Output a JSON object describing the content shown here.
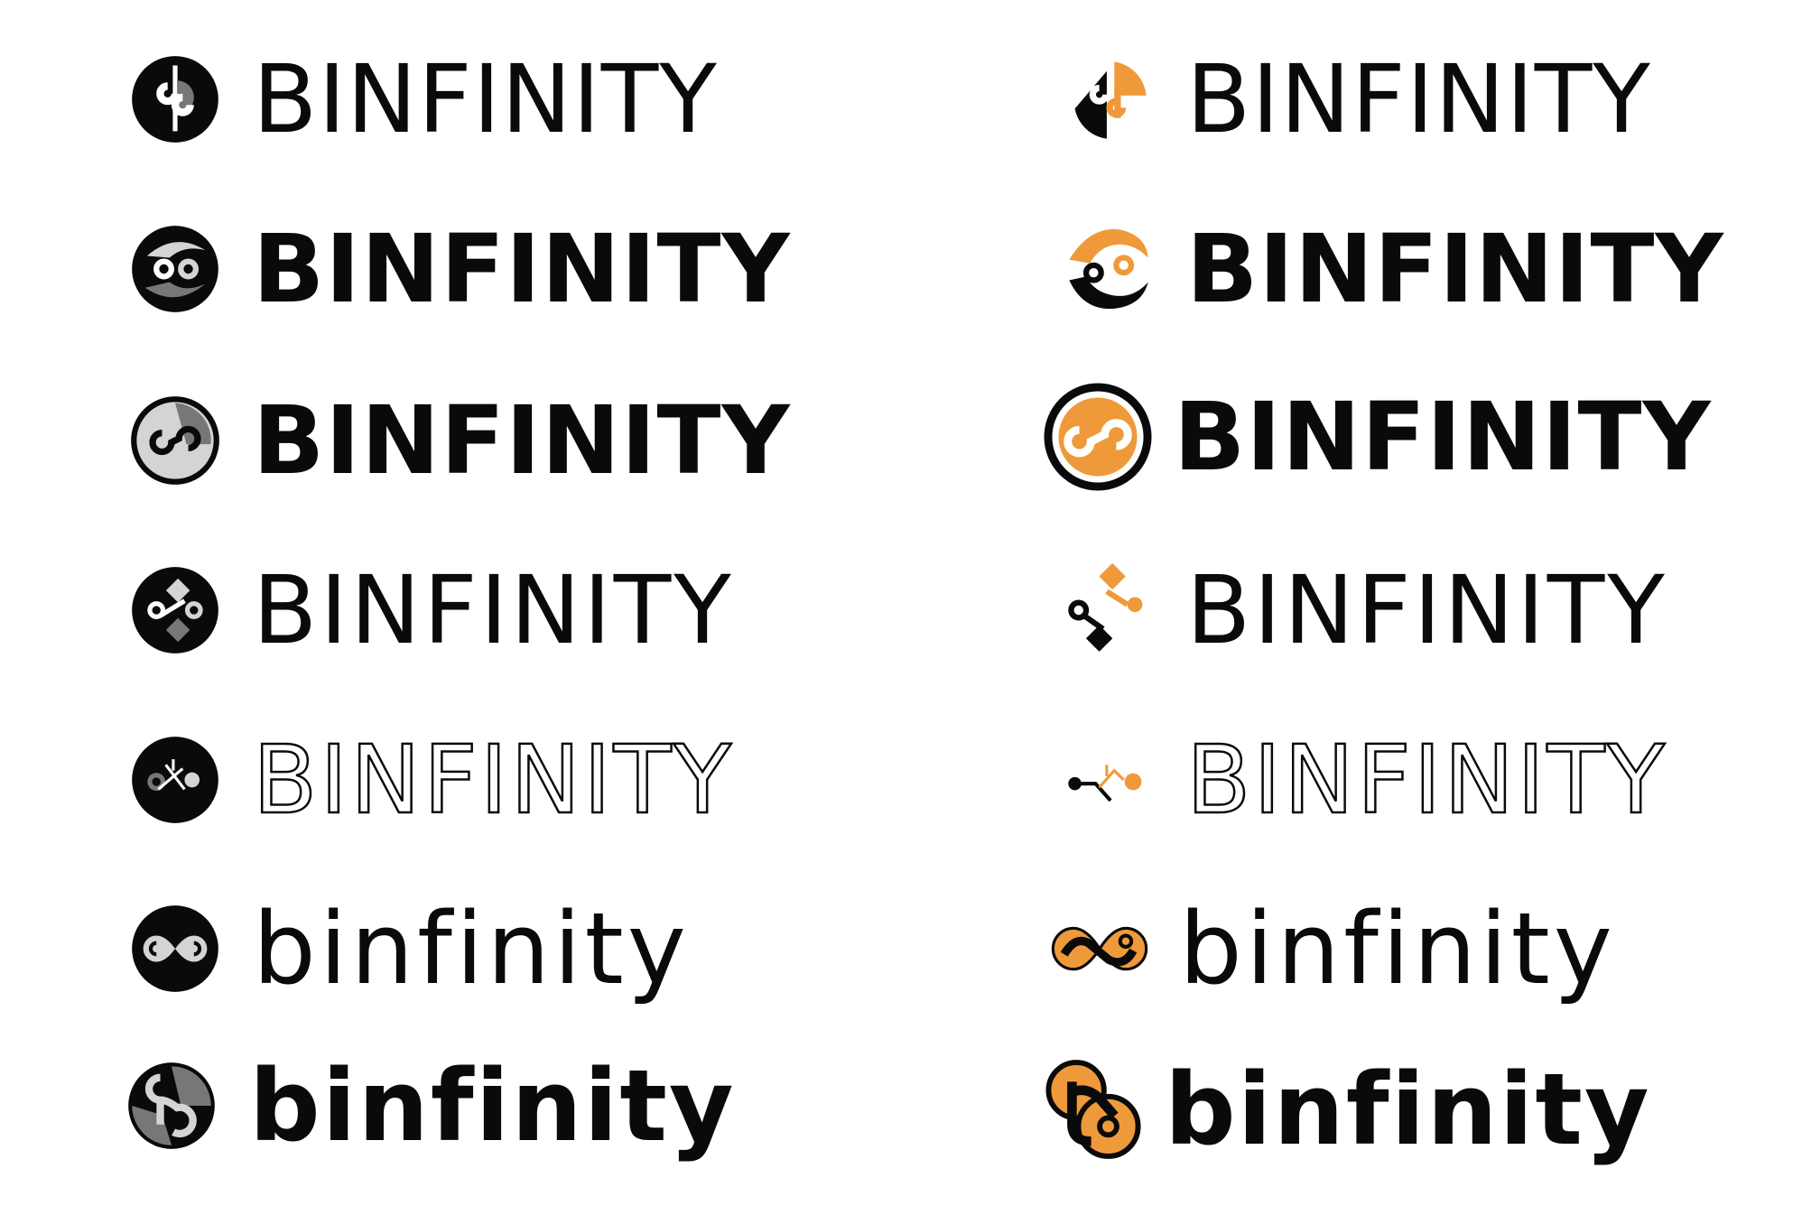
{
  "colors": {
    "ink": "#0a0a0a",
    "accent": "#ef9a3a",
    "gray": "#777777",
    "light": "#d4d4d4"
  },
  "logos": [
    {
      "word": "BINFINITY",
      "mark": "circle-b-split-icon"
    },
    {
      "word": "BINFINITY",
      "mark": "b-split-orange-icon"
    },
    {
      "word": "BINFINITY",
      "mark": "circle-swirl-icon"
    },
    {
      "word": "BINFINITY",
      "mark": "swirl-orange-icon"
    },
    {
      "word": "BINFINITY",
      "mark": "ring-infinity-gray-icon"
    },
    {
      "word": "BINFINITY",
      "mark": "ring-infinity-orange-icon"
    },
    {
      "word": "BINFINITY",
      "mark": "circle-diamond-knot-icon"
    },
    {
      "word": "BINFINITY",
      "mark": "diamond-knot-orange-icon"
    },
    {
      "word": "BINFINITY",
      "mark": "circle-thin-knot-icon"
    },
    {
      "word": "BINFINITY",
      "mark": "thin-knot-orange-icon"
    },
    {
      "word": "binfinity",
      "mark": "circle-infinity-light-icon"
    },
    {
      "word": "binfinity",
      "mark": "infinity-orange-icon"
    },
    {
      "word": "binfinity",
      "mark": "circle-b-loop-icon"
    },
    {
      "word": "binfinity",
      "mark": "b-loop-orange-icon"
    }
  ]
}
